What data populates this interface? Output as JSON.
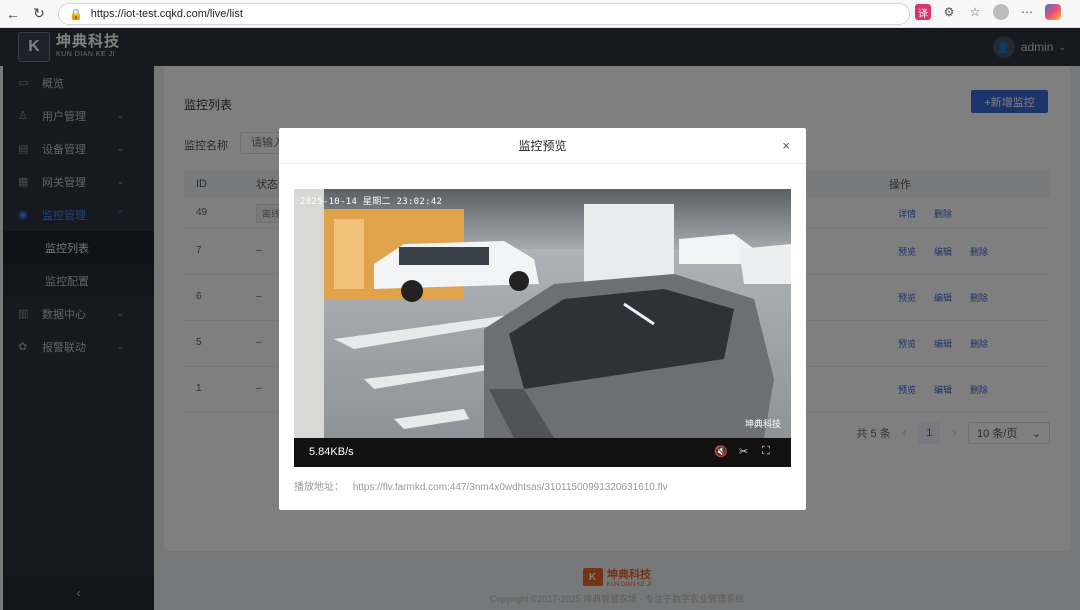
{
  "browser": {
    "url": "https://iot-test.cqkd.com/live/list"
  },
  "brand": {
    "logo_letter": "K",
    "name_cn": "坤典科技",
    "name_en": "KUN DIAN KE JI"
  },
  "user": {
    "name": "admin"
  },
  "sidebar": {
    "items": [
      {
        "label": "概览",
        "icon": "monitor-icon"
      },
      {
        "label": "用户管理",
        "icon": "user-icon"
      },
      {
        "label": "设备管理",
        "icon": "device-icon"
      },
      {
        "label": "网关管理",
        "icon": "gateway-icon"
      },
      {
        "label": "监控管理",
        "icon": "camera-icon"
      }
    ],
    "submenu": [
      {
        "label": "监控列表"
      },
      {
        "label": "监控配置"
      }
    ],
    "items_after": [
      {
        "label": "数据中心",
        "icon": "chart-icon"
      },
      {
        "label": "报警联动",
        "icon": "alarm-icon"
      }
    ],
    "collapse_glyph": "‹"
  },
  "page": {
    "title": "监控列表",
    "add_button": "+新增监控",
    "search_label": "监控名称",
    "search_placeholder": "请输入"
  },
  "table": {
    "headers": {
      "id": "ID",
      "status": "状态",
      "op": "操作"
    },
    "rows": [
      {
        "id": "49",
        "status": "离线",
        "ops": [
          "详情",
          "删除"
        ]
      },
      {
        "id": "7",
        "status": "–",
        "ops": [
          "预览",
          "编辑",
          "删除"
        ]
      },
      {
        "id": "6",
        "status": "–",
        "ops": [
          "预览",
          "编辑",
          "删除"
        ]
      },
      {
        "id": "5",
        "status": "–",
        "ops": [
          "预览",
          "编辑",
          "删除"
        ]
      },
      {
        "id": "1",
        "status": "–",
        "ops": [
          "预览",
          "编辑",
          "删除"
        ]
      }
    ]
  },
  "pagination": {
    "total": "共 5 条",
    "current": "1",
    "page_size": "10 条/页"
  },
  "footer": {
    "logo_cn": "坤典科技",
    "logo_en": "KUN DIAN KE JI",
    "copyright": "Copyright ©2017-2025 坤典智慧农场 · 专注于数字农业管理系统"
  },
  "modal": {
    "title": "监控预览",
    "close_glyph": "×",
    "osd_time": "2025-10-14 星期二 23:02:42",
    "osd_brand": "坤典科技",
    "speed": "5.84KB/s",
    "play_label": "播放地址：",
    "play_url": "https://flv.farmkd.com:447/3nm4x0wdhtsas/31011500991320631610.flv"
  }
}
